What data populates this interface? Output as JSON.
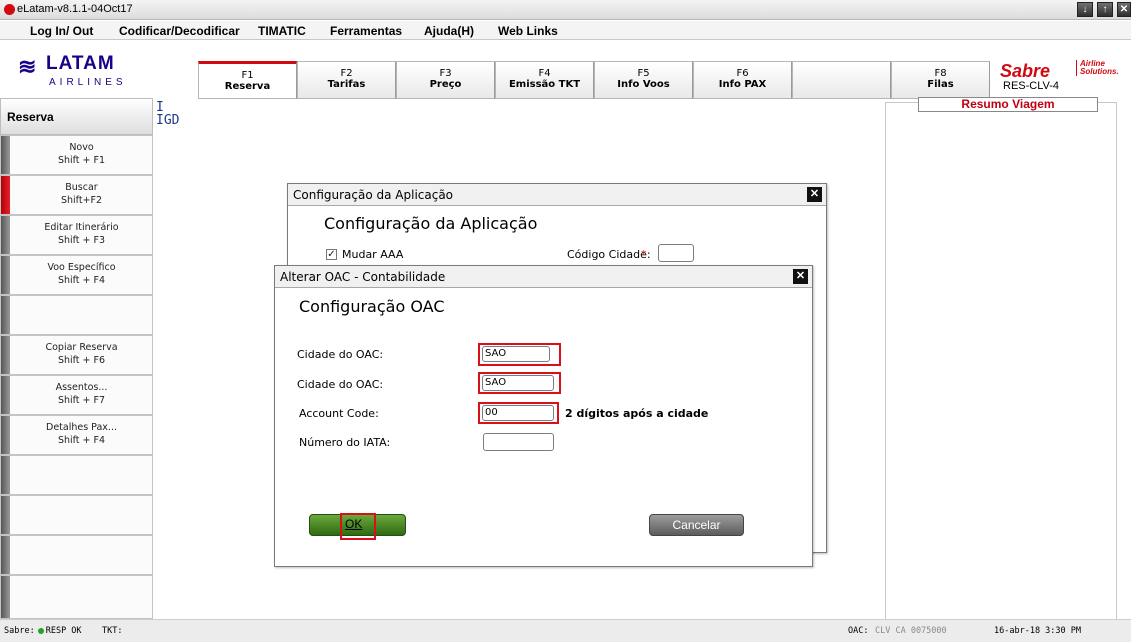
{
  "window": {
    "title": "eLatam-v8.1.1-04Oct17",
    "controls": [
      "↓",
      "↑",
      "✕"
    ]
  },
  "menu": [
    "Log In/ Out",
    "Codificar/Decodificar",
    "TIMATIC",
    "Ferramentas",
    "Ajuda(H)",
    "Web Links"
  ],
  "brand": {
    "latam": "LATAM",
    "airlines": "AIRLINES",
    "sabre": "Sabre",
    "sabre_sub1": "Airline",
    "sabre_sub2": "Solutions.",
    "res": "RES-CLV-4"
  },
  "fkeys": [
    {
      "key": "F1",
      "name": "Reserva"
    },
    {
      "key": "F2",
      "name": "Tarifas"
    },
    {
      "key": "F3",
      "name": "Preço"
    },
    {
      "key": "F4",
      "name": "Emissão TKT"
    },
    {
      "key": "F5",
      "name": "Info Voos"
    },
    {
      "key": "F6",
      "name": "Info PAX"
    },
    {
      "key": "",
      "name": ""
    },
    {
      "key": "F8",
      "name": "Filas"
    }
  ],
  "sidebar": {
    "header": "Reserva",
    "items": [
      {
        "l1": "Novo",
        "l2": "Shift + F1"
      },
      {
        "l1": "Buscar",
        "l2": "Shift+F2"
      },
      {
        "l1": "Editar Itinerário",
        "l2": "Shift + F3"
      },
      {
        "l1": "Voo Específico",
        "l2": "Shift + F4"
      },
      {
        "l1": "",
        "l2": ""
      },
      {
        "l1": "Copiar Reserva",
        "l2": "Shift + F6"
      },
      {
        "l1": "Assentos...",
        "l2": "Shift + F7"
      },
      {
        "l1": "Detalhes Pax...",
        "l2": "Shift + F4"
      },
      {
        "l1": "",
        "l2": ""
      },
      {
        "l1": "",
        "l2": ""
      },
      {
        "l1": "",
        "l2": ""
      },
      {
        "l1": "",
        "l2": ""
      }
    ]
  },
  "terminal": {
    "line1": "I",
    "line2": "IGD"
  },
  "resumo": {
    "title": "Resumo Viagem"
  },
  "config_dialog": {
    "title": "Configuração da Aplicação",
    "heading": "Configuração da Aplicação",
    "mudar_aaa": "Mudar AAA",
    "codigo_cidade": "Código Cidade:",
    "required": "*"
  },
  "oac_dialog": {
    "title": "Alterar OAC - Contabilidade",
    "heading": "Configuração OAC",
    "fields": [
      {
        "label": "Cidade do OAC:",
        "value": "SAO"
      },
      {
        "label": "Cidade do OAC:",
        "value": "SAO"
      },
      {
        "label": "Account Code:",
        "value": "00"
      },
      {
        "label": "Número do IATA:",
        "value": ""
      }
    ],
    "hint": "2 dígitos após a cidade",
    "ok": "OK",
    "cancel": "Cancelar"
  },
  "status": {
    "sabre": "Sabre:",
    "resp": "RESP OK",
    "tkt": "TKT:",
    "oac": "OAC:",
    "oac_value": "CLV CA 0075000",
    "datetime": "16-abr-18 3:30 PM"
  },
  "colors": {
    "accent": "#d10a11",
    "latam_blue": "#1b0088",
    "ok_green": "#3f7a1e"
  }
}
